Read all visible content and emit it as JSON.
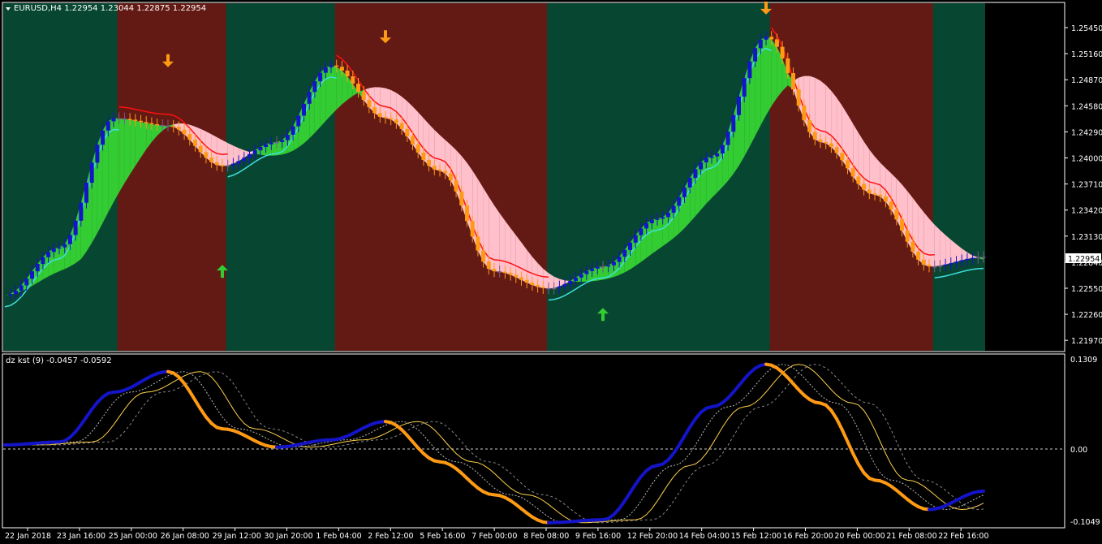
{
  "main_chart": {
    "symbol_header": "EURUSD,H4  1.22954 1.23044 1.22875 1.22954",
    "menu_icon": "triangle-down-icon",
    "current_price_label": "1.22954",
    "price_axis_labels": [
      "1.25450",
      "1.25160",
      "1.24870",
      "1.24580",
      "1.24290",
      "1.24000",
      "1.23710",
      "1.23420",
      "1.23130",
      "1.22840",
      "1.22550",
      "1.22260",
      "1.21970"
    ],
    "colors": {
      "bull": "#1414c8",
      "bear": "#ff9a14",
      "neutral": "#7a5a8a",
      "bull_band": "#33cc33",
      "bear_band": "#ffc0cb",
      "bg_down": "#641a14",
      "bg_up": "#074631",
      "line_up": "#40e0e0",
      "line_down": "#ff1010"
    }
  },
  "sub_chart": {
    "header": "dz kst (9) -0.0457 -0.0592",
    "axis_labels": {
      "top": "0.1309",
      "zero": "0.00",
      "bottom": "-0.1049"
    }
  },
  "time_axis_labels": [
    "22 Jan 2018",
    "23 Jan 16:00",
    "25 Jan 00:00",
    "26 Jan 08:00",
    "29 Jan 12:00",
    "30 Jan 20:00",
    "1 Feb 04:00",
    "2 Feb 12:00",
    "5 Feb 16:00",
    "7 Feb 00:00",
    "8 Feb 08:00",
    "9 Feb 16:00",
    "12 Feb 20:00",
    "14 Feb 04:00",
    "15 Feb 12:00",
    "16 Feb 20:00",
    "20 Feb 00:00",
    "21 Feb 08:00",
    "22 Feb 16:00"
  ],
  "chart_data": [
    {
      "type": "candlestick",
      "title": "EURUSD,H4",
      "ylim": [
        1.2197,
        1.256
      ],
      "signals": [
        {
          "type": "sell",
          "time": "26 Jan 08:00",
          "price": 1.25
        },
        {
          "type": "buy",
          "time": "29 Jan 12:00",
          "price": 1.228
        },
        {
          "type": "sell",
          "time": "2 Feb 12:00",
          "price": 1.2525
        },
        {
          "type": "buy",
          "time": "9 Feb 16:00",
          "price": 1.2235
        },
        {
          "type": "sell",
          "time": "15 Feb 12:00",
          "price": 1.2555
        }
      ],
      "close_path": [
        {
          "t": "22 Jan 2018",
          "price": 1.2255
        },
        {
          "t": "23 Jan 16:00",
          "price": 1.2305
        },
        {
          "t": "25 Jan 00:00",
          "price": 1.244
        },
        {
          "t": "26 Jan 08:00",
          "price": 1.2432
        },
        {
          "t": "29 Jan 12:00",
          "price": 1.239
        },
        {
          "t": "30 Jan 20:00",
          "price": 1.2415
        },
        {
          "t": "1 Feb 04:00",
          "price": 1.2495
        },
        {
          "t": "2 Feb 12:00",
          "price": 1.244
        },
        {
          "t": "5 Feb 16:00",
          "price": 1.2385
        },
        {
          "t": "7 Feb 00:00",
          "price": 1.228
        },
        {
          "t": "8 Feb 08:00",
          "price": 1.2262
        },
        {
          "t": "9 Feb 16:00",
          "price": 1.2285
        },
        {
          "t": "12 Feb 20:00",
          "price": 1.2335
        },
        {
          "t": "14 Feb 04:00",
          "price": 1.24
        },
        {
          "t": "15 Feb 12:00",
          "price": 1.2525
        },
        {
          "t": "16 Feb 20:00",
          "price": 1.2415
        },
        {
          "t": "20 Feb 00:00",
          "price": 1.236
        },
        {
          "t": "21 Feb 08:00",
          "price": 1.2285
        },
        {
          "t": "22 Feb 16:00",
          "price": 1.2295
        }
      ]
    },
    {
      "type": "line",
      "title": "dz kst (9)",
      "ylim": [
        -0.1049,
        0.1309
      ],
      "series": [
        {
          "name": "kst",
          "values": [
            {
              "t": "22 Jan 2018",
              "v": 0.008
            },
            {
              "t": "23 Jan 16:00",
              "v": 0.012
            },
            {
              "t": "25 Jan 00:00",
              "v": 0.08
            },
            {
              "t": "26 Jan 08:00",
              "v": 0.108
            },
            {
              "t": "29 Jan 12:00",
              "v": 0.03
            },
            {
              "t": "30 Jan 20:00",
              "v": 0.005
            },
            {
              "t": "1 Feb 04:00",
              "v": 0.015
            },
            {
              "t": "2 Feb 12:00",
              "v": 0.04
            },
            {
              "t": "5 Feb 16:00",
              "v": -0.015
            },
            {
              "t": "7 Feb 00:00",
              "v": -0.06
            },
            {
              "t": "8 Feb 08:00",
              "v": -0.098
            },
            {
              "t": "9 Feb 16:00",
              "v": -0.094
            },
            {
              "t": "12 Feb 20:00",
              "v": -0.02
            },
            {
              "t": "14 Feb 04:00",
              "v": 0.06
            },
            {
              "t": "15 Feb 12:00",
              "v": 0.118
            },
            {
              "t": "16 Feb 20:00",
              "v": 0.065
            },
            {
              "t": "20 Feb 00:00",
              "v": -0.04
            },
            {
              "t": "21 Feb 08:00",
              "v": -0.08
            },
            {
              "t": "22 Feb 16:00",
              "v": -0.055
            }
          ]
        }
      ]
    }
  ]
}
